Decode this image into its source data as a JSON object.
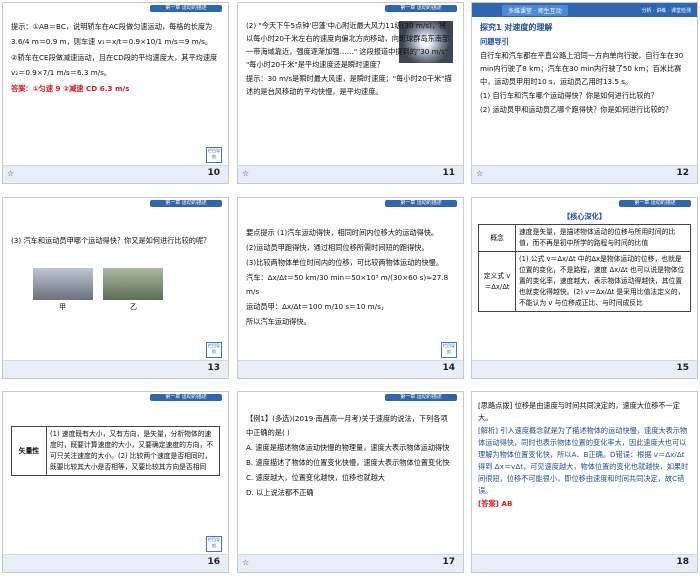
{
  "header_label": "第一章  运动的描述",
  "nav_label": "栏目导航",
  "slides": [
    {
      "num": "10",
      "lines": [
        "提示：①AB＝BC，说明轿车在AC段做匀速运动，每格的长度为 3.6/4 m＝0.9 m，则车速 v₁＝x/t＝0.9×10/1 m/s＝9 m/s。",
        "②轿车在CE段做减速运动，且在CD段的平均速度大，其平均速度 v₂＝0.9×7/1 m/s＝6.3 m/s。"
      ],
      "answer": "答案：①匀速  9  ②减速  CD  6.3 m/s"
    },
    {
      "num": "11",
      "lines": [
        "(2) \"今天下午5点钟'巴蓬'中心附近最大风力11级(30 m/s)，将以每小时20千米左右的速度向偏北方向移动，向斑球群岛东南部一带海域靠近，强度逐渐加强……\" 这段报道中提到的\"30 m/s\" \"每小时20千米\"是平均速度还是瞬时速度？",
        "提示：30 m/s是瞬时最大风速，是瞬时速度；\"每小时20千米\"描述的是台风移动的平均快慢，是平均速度。"
      ]
    },
    {
      "num": "12",
      "band_tag": "多维课堂 · 师生互动",
      "band_right": "分析 · 讲练 · 课堂检测",
      "title": "探究1  对速度的理解",
      "sub": "问题导引",
      "lines": [
        "自行车和汽车都在平直公路上沿同一方向单向行驶，自行车在30 min内行驶了8 km；汽车在30 min内行驶了50 km；百米比赛中，运动员甲用时10 s，运动员乙用时13.5 s。",
        "(1) 自行车和汽车哪个运动得快？你是如何进行比较的？",
        "(2) 运动员甲和运动员乙哪个跑得快？你是如何进行比较的？"
      ]
    },
    {
      "num": "13",
      "lines": [
        "(3) 汽车和运动员甲哪个运动得快？你又是如何进行比较的呢？"
      ],
      "captions": [
        "甲",
        "乙"
      ]
    },
    {
      "num": "14",
      "lines": [
        "要点提示  (1)汽车运动得快，相同时间内位移大的运动得快。",
        "(2)运动员甲跑得快，通过相同位移所需时间短的跑得快。",
        "(3)比较两物体单位时间内的位移，可比较两物体运动的快慢。",
        "汽车：Δx/Δt＝50 km/30 min＝50×10³ m/(30×60 s)≈27.8 m/s",
        "运动员甲：Δx/Δt＝100 m/10 s＝10 m/s，",
        "所以汽车运动得快。"
      ]
    },
    {
      "num": "15",
      "title": "【核心深化】",
      "rows": [
        {
          "k": "概念",
          "v": "速度是矢量，是描述物体运动的位移与所用时间的比值，而不再是初中所学的路程与时间的比值"
        },
        {
          "k": "定义式 v＝Δx/Δt",
          "v": "(1) 公式 v＝Δx/Δt 中的Δx是物体运动的位移，也就是位置的变化，不是路程，速度 Δx/Δt 也可以说是物体位置的变化率，速度越大，表示物体运动得越快，其位置也就变化得越快。(2) v＝Δx/Δt 是采用比值法定义的，不能认为 v 与位移成正比、与时间成反比"
        }
      ]
    },
    {
      "num": "16",
      "rows": [
        {
          "k": "矢量性",
          "v": "(1) 速度既有大小，又有方向，是矢量，分析物体的速度时，既要计算速度的大小，又要确定速度的方向，不可只关注速度的大小。(2) 比较两个速度是否相同时，既要比较其大小是否相等，又要比较其方向是否相同"
        }
      ]
    },
    {
      "num": "17",
      "lines": [
        "【例1】(多选)(2019·南昌高一月考)关于速度的说法，下列各项中正确的是(    )",
        "A. 速度是描述物体运动快慢的物理量，速度大表示物体运动得快",
        "B. 速度描述了物体的位置变化快慢，速度大表示物体位置变化快",
        "C. 速度越大，位置变化越快，位移也就越大",
        "D. 以上说法都不正确"
      ]
    },
    {
      "num": "18",
      "lines": [
        "[思路点拨] 位移是由速度与时间共同决定的，速度大位移不一定大。",
        "[解析] 引入速度概念就是为了描述物体的运动快慢，速度大表示物体运动得快，同时也表示物体位置的变化率大，因此速度大也可以理解为物体位置变化快，所以A、B正确。D错误：根据 v＝Δx/Δt 得到 Δx＝vΔt，可见速度越大，物体位置的变化也就越快，如果时间很短，位移不可能很小，即位移由速度和时间共同决定，故C错误。",
        "[答案] AB"
      ]
    }
  ]
}
